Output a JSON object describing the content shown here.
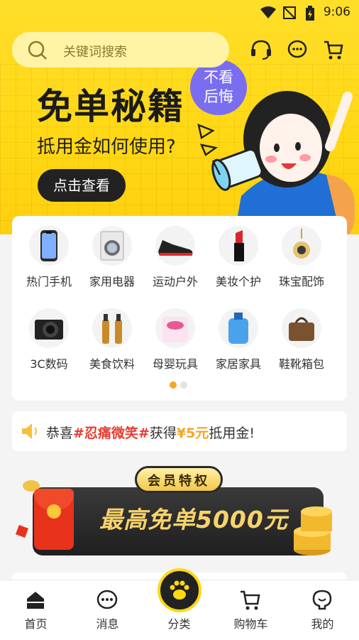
{
  "status": {
    "time": "9:06"
  },
  "search": {
    "placeholder": "关键词搜索"
  },
  "hero": {
    "title": "免单秘籍",
    "subtitle": "抵用金如何使用?",
    "cta": "点击查看",
    "bubble_line1": "不看",
    "bubble_line2": "后悔"
  },
  "categories": [
    {
      "label": "热门手机",
      "icon": "phone-icon"
    },
    {
      "label": "家用电器",
      "icon": "washing-machine-icon"
    },
    {
      "label": "运动户外",
      "icon": "sneaker-icon"
    },
    {
      "label": "美妆个护",
      "icon": "lipstick-icon"
    },
    {
      "label": "珠宝配饰",
      "icon": "pendant-icon"
    },
    {
      "label": "3C数码",
      "icon": "camera-icon"
    },
    {
      "label": "美食饮料",
      "icon": "beer-icon"
    },
    {
      "label": "母婴玩具",
      "icon": "diaper-icon"
    },
    {
      "label": "家居家具",
      "icon": "detergent-icon"
    },
    {
      "label": "鞋靴箱包",
      "icon": "handbag-icon"
    }
  ],
  "notice": {
    "prefix": "恭喜",
    "name": "#忍痛微笑#",
    "mid": "获得",
    "amount": "¥5元",
    "suffix": "抵用金!"
  },
  "vip": {
    "tag": "会员特权",
    "headline": "最高免单5000元"
  },
  "tabs": [
    {
      "label": "首页",
      "icon": "home-icon"
    },
    {
      "label": "消息",
      "icon": "message-icon"
    },
    {
      "label": "分类",
      "icon": "paw-icon"
    },
    {
      "label": "购物车",
      "icon": "cart-icon"
    },
    {
      "label": "我的",
      "icon": "profile-icon"
    }
  ],
  "colors": {
    "brand_yellow": "#ffd814",
    "accent_red": "#e63c2f",
    "tab_active_dot": "#f5a623"
  }
}
